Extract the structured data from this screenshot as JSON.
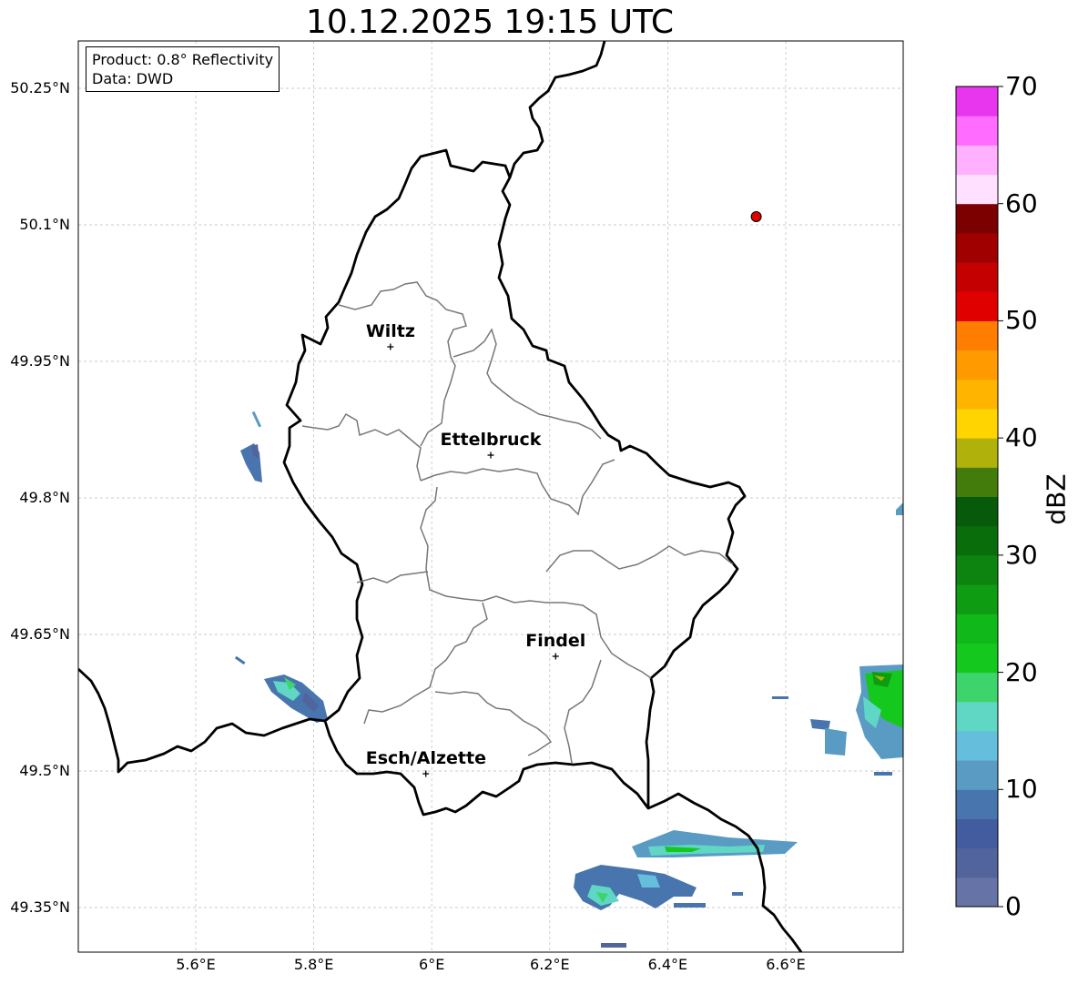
{
  "title": "10.12.2025 19:15 UTC",
  "info": {
    "product_line": "Product: 0.8° Reflectivity",
    "data_line": "Data: DWD"
  },
  "axes": {
    "lat_labels": [
      "50.25°N",
      "50.1°N",
      "49.95°N",
      "49.8°N",
      "49.65°N",
      "49.5°N",
      "49.35°N"
    ],
    "lon_labels": [
      "5.6°E",
      "5.8°E",
      "6°E",
      "6.2°E",
      "6.4°E",
      "6.6°E"
    ],
    "lat_values": [
      50.25,
      50.1,
      49.95,
      49.8,
      49.65,
      49.5,
      49.35
    ],
    "lon_values": [
      5.6,
      5.8,
      6.0,
      6.2,
      6.4,
      6.6
    ],
    "lon_range": [
      5.4,
      6.8
    ],
    "lat_range": [
      49.3,
      50.3
    ],
    "grid": true
  },
  "cities": [
    {
      "name": "Wiltz",
      "lon": 5.93,
      "lat": 49.966
    },
    {
      "name": "Ettelbruck",
      "lon": 6.1,
      "lat": 49.847
    },
    {
      "name": "Findel",
      "lon": 6.21,
      "lat": 49.626
    },
    {
      "name": "Esch/Alzette",
      "lon": 5.99,
      "lat": 49.497
    }
  ],
  "radar_site": {
    "lon": 6.55,
    "lat": 50.109,
    "color": "#e00000"
  },
  "colorbar": {
    "label": "dBZ",
    "min": 0,
    "max": 70,
    "ticks": [
      "0",
      "10",
      "20",
      "30",
      "40",
      "50",
      "60",
      "70"
    ],
    "colors": [
      "#6673a6",
      "#52649c",
      "#435c9f",
      "#4875ad",
      "#5a9bc4",
      "#64bedc",
      "#60d6c4",
      "#3dd46c",
      "#14c81e",
      "#10b819",
      "#0e9d12",
      "#0d8410",
      "#0a6d0c",
      "#065a09",
      "#437c0b",
      "#b0b10a",
      "#ffd400",
      "#ffb400",
      "#ff9b00",
      "#ff7d00",
      "#e00000",
      "#c40000",
      "#a10000",
      "#7c0000",
      "#ffe0ff",
      "#ffb0ff",
      "#ff6cff",
      "#e835ee"
    ]
  }
}
